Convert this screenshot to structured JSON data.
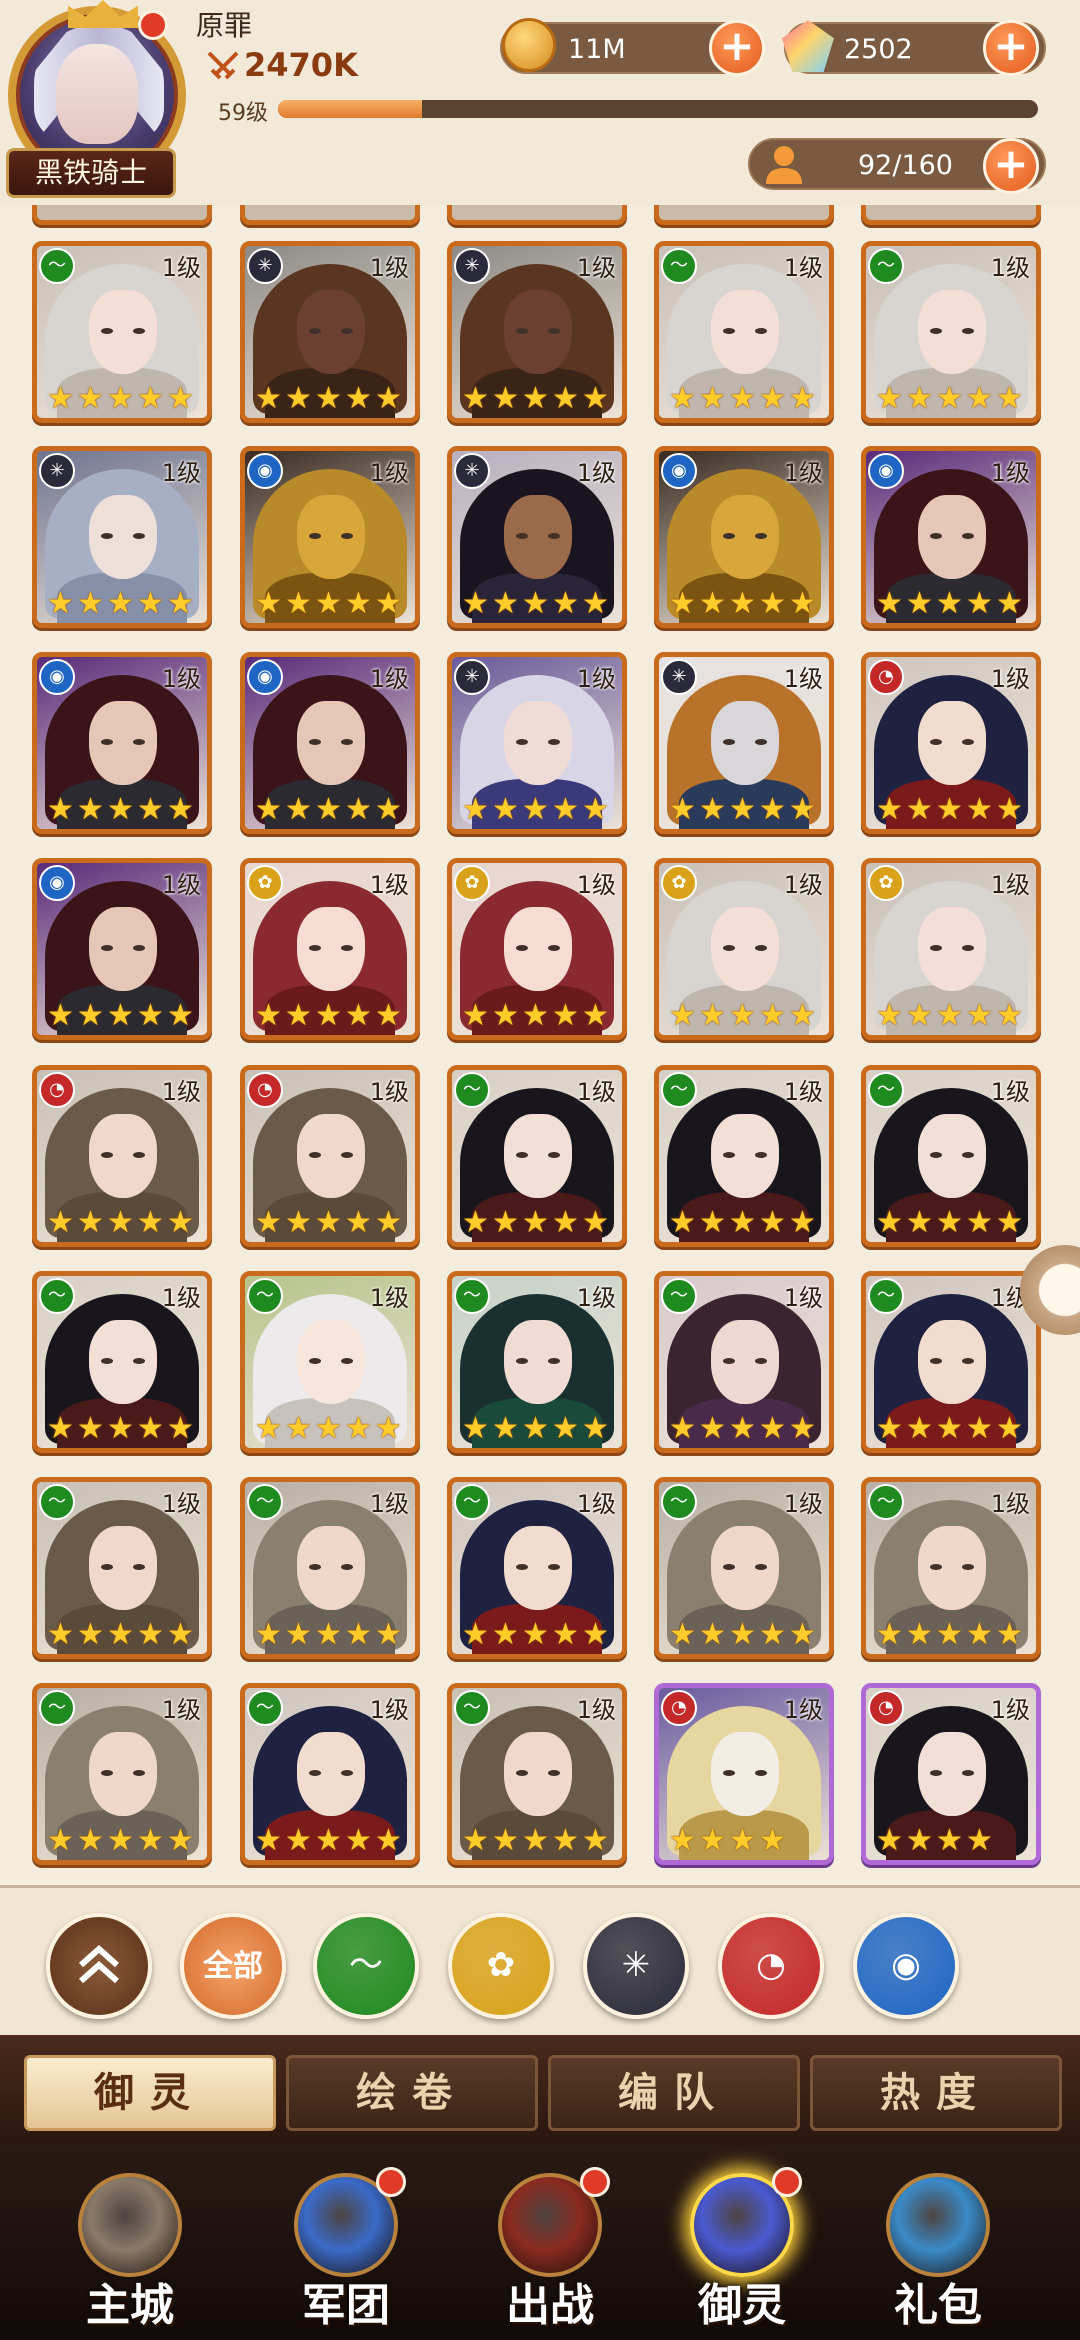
{
  "player": {
    "name": "原罪",
    "power": "2470K",
    "level_text": "59级",
    "exp_progress": 0.19,
    "rank_title": "黑铁骑士"
  },
  "resources": {
    "gold": "11M",
    "gems": "2502",
    "roster": "92/160"
  },
  "element_colors": {
    "nature": "#1f8a1f",
    "light": "#d9a21a",
    "dark": "#2a2a3a",
    "fire": "#c42828",
    "water": "#1f66c4"
  },
  "cards": [
    {
      "level": "1级",
      "element": "nature",
      "stars": 5,
      "palette": "silver"
    },
    {
      "level": "1级",
      "element": "dark",
      "stars": 5,
      "palette": "bull"
    },
    {
      "level": "1级",
      "element": "dark",
      "stars": 5,
      "palette": "bull"
    },
    {
      "level": "1级",
      "element": "nature",
      "stars": 5,
      "palette": "silver"
    },
    {
      "level": "1级",
      "element": "nature",
      "stars": 5,
      "palette": "silver"
    },
    {
      "level": "1级",
      "element": "dark",
      "stars": 5,
      "palette": "grey"
    },
    {
      "level": "1级",
      "element": "water",
      "stars": 5,
      "palette": "gold"
    },
    {
      "level": "1级",
      "element": "dark",
      "stars": 5,
      "palette": "tan"
    },
    {
      "level": "1级",
      "element": "water",
      "stars": 5,
      "palette": "gold"
    },
    {
      "level": "1级",
      "element": "water",
      "stars": 5,
      "palette": "maroon"
    },
    {
      "level": "1级",
      "element": "water",
      "stars": 5,
      "palette": "maroon"
    },
    {
      "level": "1级",
      "element": "water",
      "stars": 5,
      "palette": "maroon"
    },
    {
      "level": "1级",
      "element": "dark",
      "stars": 5,
      "palette": "violet"
    },
    {
      "level": "1级",
      "element": "dark",
      "stars": 5,
      "palette": "masked"
    },
    {
      "level": "1级",
      "element": "fire",
      "stars": 5,
      "palette": "navy"
    },
    {
      "level": "1级",
      "element": "water",
      "stars": 5,
      "palette": "maroon"
    },
    {
      "level": "1级",
      "element": "light",
      "stars": 5,
      "palette": "red"
    },
    {
      "level": "1级",
      "element": "light",
      "stars": 5,
      "palette": "red"
    },
    {
      "level": "1级",
      "element": "light",
      "stars": 5,
      "palette": "silver"
    },
    {
      "level": "1级",
      "element": "light",
      "stars": 5,
      "palette": "silver"
    },
    {
      "level": "1级",
      "element": "fire",
      "stars": 5,
      "palette": "brown"
    },
    {
      "level": "1级",
      "element": "fire",
      "stars": 5,
      "palette": "brown"
    },
    {
      "level": "1级",
      "element": "nature",
      "stars": 5,
      "palette": "black"
    },
    {
      "level": "1级",
      "element": "nature",
      "stars": 5,
      "palette": "black"
    },
    {
      "level": "1级",
      "element": "nature",
      "stars": 5,
      "palette": "black"
    },
    {
      "level": "1级",
      "element": "nature",
      "stars": 5,
      "palette": "black"
    },
    {
      "level": "1级",
      "element": "nature",
      "stars": 5,
      "palette": "white"
    },
    {
      "level": "1级",
      "element": "nature",
      "stars": 5,
      "palette": "teal"
    },
    {
      "level": "1级",
      "element": "nature",
      "stars": 5,
      "palette": "plum"
    },
    {
      "level": "1级",
      "element": "nature",
      "stars": 5,
      "palette": "navy"
    },
    {
      "level": "1级",
      "element": "nature",
      "stars": 5,
      "palette": "brown"
    },
    {
      "level": "1级",
      "element": "nature",
      "stars": 5,
      "palette": "ash"
    },
    {
      "level": "1级",
      "element": "nature",
      "stars": 5,
      "palette": "navy"
    },
    {
      "level": "1级",
      "element": "nature",
      "stars": 5,
      "palette": "ash"
    },
    {
      "level": "1级",
      "element": "nature",
      "stars": 5,
      "palette": "ash"
    },
    {
      "level": "1级",
      "element": "nature",
      "stars": 5,
      "palette": "ash"
    },
    {
      "level": "1级",
      "element": "nature",
      "stars": 5,
      "palette": "navy"
    },
    {
      "level": "1级",
      "element": "nature",
      "stars": 5,
      "palette": "brown"
    },
    {
      "level": "1级",
      "element": "fire",
      "stars": 4,
      "palette": "armor",
      "frame": "purple"
    },
    {
      "level": "1级",
      "element": "fire",
      "stars": 4,
      "palette": "black",
      "frame": "purple"
    }
  ],
  "filters": {
    "collapse_icon": "double-chevron-up-icon",
    "all_label": "全部",
    "elements": [
      "nature",
      "light",
      "dark",
      "fire",
      "water"
    ]
  },
  "tabs": [
    "御灵",
    "绘卷",
    "编队",
    "热度"
  ],
  "nav": [
    {
      "label": "主城",
      "icon": "castle-icon",
      "badge": false
    },
    {
      "label": "军团",
      "icon": "fist-shield-icon",
      "badge": true
    },
    {
      "label": "出战",
      "icon": "sword-gate-icon",
      "badge": true
    },
    {
      "label": "御灵",
      "icon": "crystal-icon",
      "badge": true,
      "active": true
    },
    {
      "label": "礼包",
      "icon": "shop-stall-icon",
      "badge": false
    }
  ]
}
